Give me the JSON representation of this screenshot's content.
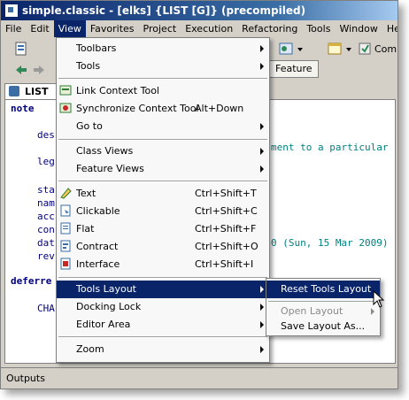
{
  "window": {
    "title": "simple.classic - [elks] {LIST [G]} (precompiled)"
  },
  "menubar": [
    "File",
    "Edit",
    "View",
    "Favorites",
    "Project",
    "Execution",
    "Refactoring",
    "Tools",
    "Window",
    "Help"
  ],
  "toolbar": {
    "comp_label": "Comp",
    "feature_tab": "Feature"
  },
  "editor_tab": {
    "label": "LIST"
  },
  "code": {
    "note": "note",
    "snippet_tail": "ment to a particular",
    "date_tail": "0 (Sun, 15 Mar 2009)",
    "frags": [
      "des",
      "leg",
      "sta",
      "nam",
      "acc",
      "con",
      "dat",
      "rev"
    ],
    "deferred": "deferre",
    "cha": "CHA"
  },
  "outputs": {
    "label": "Outputs"
  },
  "view_menu": {
    "items": [
      {
        "label": "Toolbars",
        "submenu": true
      },
      {
        "label": "Tools",
        "submenu": true
      },
      {
        "label": "Link Context Tool",
        "icon": "link-context-icon"
      },
      {
        "label": "Synchronize Context Tool",
        "shortcut": "Alt+Down",
        "icon": "synchronize-icon"
      },
      {
        "label": "Go to",
        "submenu": true
      },
      {
        "label": "Class Views",
        "submenu": true
      },
      {
        "label": "Feature Views",
        "submenu": true
      },
      {
        "label": "Text",
        "shortcut": "Ctrl+Shift+T",
        "icon": "text-view-icon"
      },
      {
        "label": "Clickable",
        "shortcut": "Ctrl+Shift+C",
        "icon": "clickable-view-icon"
      },
      {
        "label": "Flat",
        "shortcut": "Ctrl+Shift+F",
        "icon": "flat-view-icon"
      },
      {
        "label": "Contract",
        "shortcut": "Ctrl+Shift+O",
        "icon": "contract-view-icon"
      },
      {
        "label": "Interface",
        "shortcut": "Ctrl+Shift+I",
        "icon": "interface-view-icon"
      },
      {
        "label": "Tools Layout",
        "submenu": true,
        "selected": true
      },
      {
        "label": "Docking Lock",
        "submenu": true
      },
      {
        "label": "Editor Area",
        "submenu": true
      },
      {
        "label": "Zoom",
        "submenu": true
      }
    ]
  },
  "tools_layout_submenu": {
    "items": [
      {
        "label": "Reset Tools Layout",
        "selected": true
      },
      {
        "label": "Open Layout",
        "disabled": true,
        "submenu": true
      },
      {
        "label": "Save Layout As..."
      }
    ]
  },
  "colors": {
    "selection": "#0a246a",
    "keyword": "#000080",
    "teal": "#008080"
  }
}
